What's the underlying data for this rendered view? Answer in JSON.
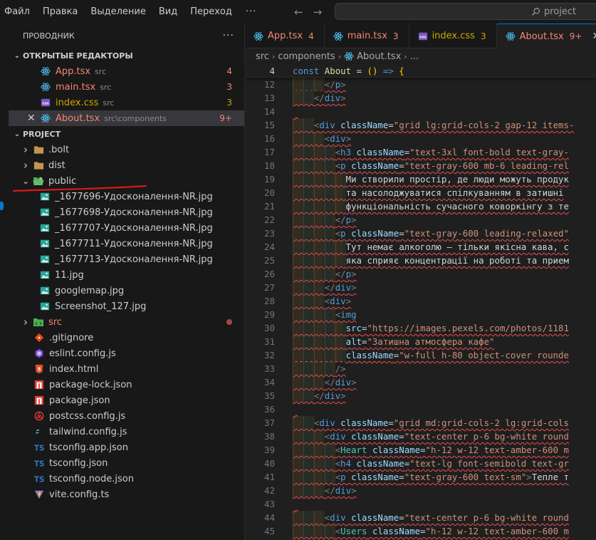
{
  "menu": [
    "Файл",
    "Правка",
    "Выделение",
    "Вид",
    "Переход"
  ],
  "menu_more": "···",
  "search": {
    "label": "project"
  },
  "sidebar": {
    "title": "ПРОВОДНИК",
    "more": "···",
    "open_editors_label": "ОТКРЫТЫЕ РЕДАКТОРЫ",
    "open_editors": [
      {
        "name": "App.tsx",
        "desc": "src",
        "badge": "4",
        "icon": "react-icon",
        "state": "mod"
      },
      {
        "name": "main.tsx",
        "desc": "src",
        "badge": "3",
        "icon": "react-icon",
        "state": "mod"
      },
      {
        "name": "index.css",
        "desc": "src",
        "badge": "3",
        "icon": "css-icon",
        "state": "warn"
      },
      {
        "name": "About.tsx",
        "desc": "src\\components",
        "badge": "9+",
        "icon": "react-icon",
        "state": "mod"
      }
    ],
    "close_glyph": "✕",
    "project_label": "PROJECT",
    "tree": [
      {
        "name": ".bolt",
        "type": "folder"
      },
      {
        "name": "dist",
        "type": "folder"
      },
      {
        "name": "public",
        "type": "folder-open"
      },
      {
        "name": "_1677696-Удосконалення-NR.jpg",
        "type": "image"
      },
      {
        "name": "_1677698-Удосконалення-NR.jpg",
        "type": "image"
      },
      {
        "name": "_1677707-Удосконалення-NR.jpg",
        "type": "image"
      },
      {
        "name": "_1677711-Удосконалення-NR.jpg",
        "type": "image"
      },
      {
        "name": "_1677713-Удосконалення-NR.jpg",
        "type": "image"
      },
      {
        "name": "11.jpg",
        "type": "image"
      },
      {
        "name": "googlemap.jpg",
        "type": "image"
      },
      {
        "name": "Screenshot_127.jpg",
        "type": "image"
      },
      {
        "name": "src",
        "type": "folder-src"
      },
      {
        "name": ".gitignore",
        "type": "git"
      },
      {
        "name": "eslint.config.js",
        "type": "eslint"
      },
      {
        "name": "index.html",
        "type": "html"
      },
      {
        "name": "package-lock.json",
        "type": "npm"
      },
      {
        "name": "package.json",
        "type": "npm"
      },
      {
        "name": "postcss.config.js",
        "type": "postcss"
      },
      {
        "name": "tailwind.config.js",
        "type": "tailwind"
      },
      {
        "name": "tsconfig.app.json",
        "type": "ts"
      },
      {
        "name": "tsconfig.json",
        "type": "ts"
      },
      {
        "name": "tsconfig.node.json",
        "type": "ts"
      },
      {
        "name": "vite.config.ts",
        "type": "vite"
      }
    ]
  },
  "tabs": [
    {
      "name": "App.tsx",
      "badge": "4",
      "icon": "react-icon",
      "state": "mod"
    },
    {
      "name": "main.tsx",
      "badge": "3",
      "icon": "react-icon",
      "state": "mod"
    },
    {
      "name": "index.css",
      "badge": "3",
      "icon": "css-icon",
      "state": "warn"
    },
    {
      "name": "About.tsx",
      "badge": "9+",
      "icon": "react-icon",
      "state": "mod",
      "active": true
    }
  ],
  "breadcrumb": [
    "src",
    "components",
    "About.tsx",
    "..."
  ],
  "editor": {
    "sticky": {
      "ln": "4",
      "code": "const About = () => {"
    },
    "lines": [
      {
        "ln": "12",
        "code": "      </p>"
      },
      {
        "ln": "13",
        "code": "    </div>"
      },
      {
        "ln": "14",
        "code": ""
      },
      {
        "ln": "15",
        "code": "    <div className=\"grid lg:grid-cols-2 gap-12 items-"
      },
      {
        "ln": "16",
        "code": "      <div>"
      },
      {
        "ln": "17",
        "code": "        <h3 className=\"text-3xl font-bold text-gray-"
      },
      {
        "ln": "18",
        "code": "        <p className=\"text-gray-600 mb-6 leading-rel"
      },
      {
        "ln": "19",
        "code": "          Ми створили простір, де люди можуть продук"
      },
      {
        "ln": "20",
        "code": "          та насолоджуватися спілкуванням в затишні"
      },
      {
        "ln": "21",
        "code": "          функціональність сучасного коворкінгу з те"
      },
      {
        "ln": "22",
        "code": "        </p>"
      },
      {
        "ln": "23",
        "code": "        <p className=\"text-gray-600 leading-relaxed\""
      },
      {
        "ln": "24",
        "code": "          Тут немає алкоголю – тільки якісна кава, с"
      },
      {
        "ln": "25",
        "code": "          яка сприяє концентрації на роботі та прием"
      },
      {
        "ln": "26",
        "code": "        </p>"
      },
      {
        "ln": "27",
        "code": "      </div>"
      },
      {
        "ln": "28",
        "code": "      <div>"
      },
      {
        "ln": "29",
        "code": "        <img"
      },
      {
        "ln": "30",
        "code": "          src=\"https://images.pexels.com/photos/1181"
      },
      {
        "ln": "31",
        "code": "          alt=\"Затишна атмосфера кафе\""
      },
      {
        "ln": "32",
        "code": "          className=\"w-full h-80 object-cover rounde"
      },
      {
        "ln": "33",
        "code": "        />"
      },
      {
        "ln": "34",
        "code": "      </div>"
      },
      {
        "ln": "35",
        "code": "    </div>"
      },
      {
        "ln": "36",
        "code": ""
      },
      {
        "ln": "37",
        "code": "    <div className=\"grid md:grid-cols-2 lg:grid-cols"
      },
      {
        "ln": "38",
        "code": "      <div className=\"text-center p-6 bg-white round"
      },
      {
        "ln": "39",
        "code": "        <Heart className=\"h-12 w-12 text-amber-600 m"
      },
      {
        "ln": "40",
        "code": "        <h4 className=\"text-lg font-semibold text-gr"
      },
      {
        "ln": "41",
        "code": "        <p className=\"text-gray-600 text-sm\">Тепле т"
      },
      {
        "ln": "42",
        "code": "      </div>"
      },
      {
        "ln": "43",
        "code": ""
      },
      {
        "ln": "44",
        "code": "      <div className=\"text-center p-6 bg-white round"
      },
      {
        "ln": "45",
        "code": "        <Users className=\"h-12 w-12 text-amber-600 m"
      }
    ]
  },
  "colors": {
    "accent": "#0078d4",
    "modified": "#f48771",
    "warning": "#cca700",
    "folder": "#c09553",
    "image": "#26a69a",
    "annotation": "#d7191c"
  }
}
